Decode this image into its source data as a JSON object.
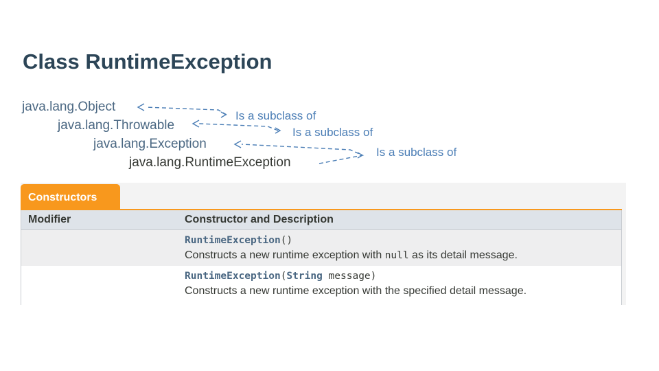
{
  "page": {
    "title": "Class RuntimeException"
  },
  "hierarchy": [
    {
      "label": "java.lang.Object"
    },
    {
      "label": "java.lang.Throwable"
    },
    {
      "label": "java.lang.Exception"
    },
    {
      "label": "java.lang.RuntimeException"
    }
  ],
  "annotations": [
    {
      "text": "Is a subclass of"
    },
    {
      "text": "Is a subclass of"
    },
    {
      "text": "Is a subclass of"
    }
  ],
  "constructors": {
    "tab_label": "Constructors",
    "headers": {
      "modifier": "Modifier",
      "description": "Constructor and Description"
    },
    "rows": [
      {
        "modifier": "",
        "method_name": "RuntimeException",
        "open_paren": "(",
        "param_type": "",
        "param_name": "",
        "close_paren": ")",
        "desc_before": "Constructs a new runtime exception with ",
        "desc_code": "null",
        "desc_after": " as its detail message."
      },
      {
        "modifier": "",
        "method_name": "RuntimeException",
        "open_paren": "(",
        "param_type": "String",
        "param_name": " message",
        "close_paren": ")",
        "desc_before": "Constructs a new runtime exception with the specified detail message.",
        "desc_code": "",
        "desc_after": ""
      }
    ]
  },
  "colors": {
    "title": "#2c4557",
    "link": "#4a6782",
    "annotation": "#4a7db5",
    "tab": "#f8981d",
    "header_bg": "#dee3e9"
  }
}
